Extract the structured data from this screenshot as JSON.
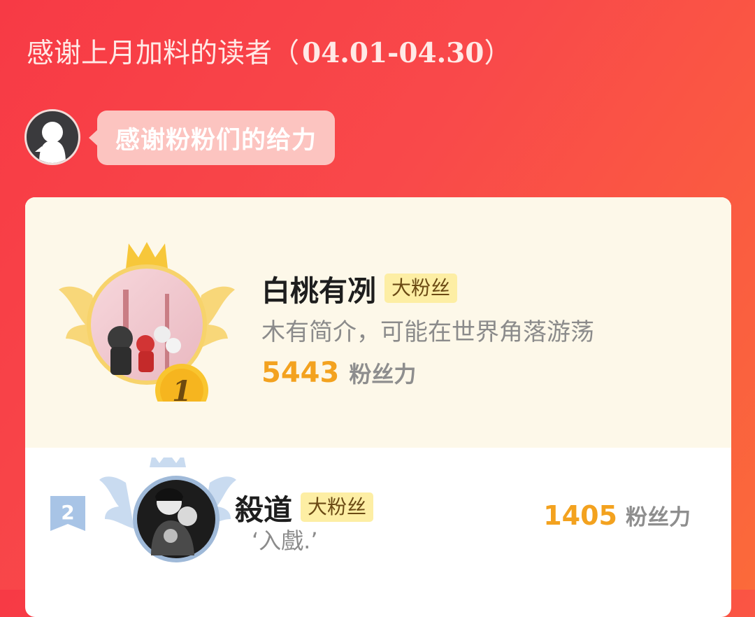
{
  "header": {
    "title_text": "感谢上月加料的读者（",
    "title_date": "04.01-04.30",
    "title_close": "）"
  },
  "host": {
    "avatar_icon": "ghost-avatar-icon",
    "bubble_text": "感谢粉粉们的给力"
  },
  "ranking": [
    {
      "rank": "1",
      "name": "白桃有冽",
      "tag": "大粉丝",
      "bio": "木有简介，可能在世界角落游荡",
      "power": "5443",
      "unit": "粉丝力"
    },
    {
      "rank": "2",
      "name": "殺道",
      "tag": "大粉丝",
      "bio": "‘入戲.’",
      "power": "1405",
      "unit": "粉丝力"
    }
  ],
  "colors": {
    "background_start": "#f73a45",
    "background_end": "#fb6a3a",
    "gold": "#f3a21f",
    "first_row_bg": "#fdf8e9",
    "tag_bg": "#fdeea4",
    "silver": "#9fb9d8"
  }
}
